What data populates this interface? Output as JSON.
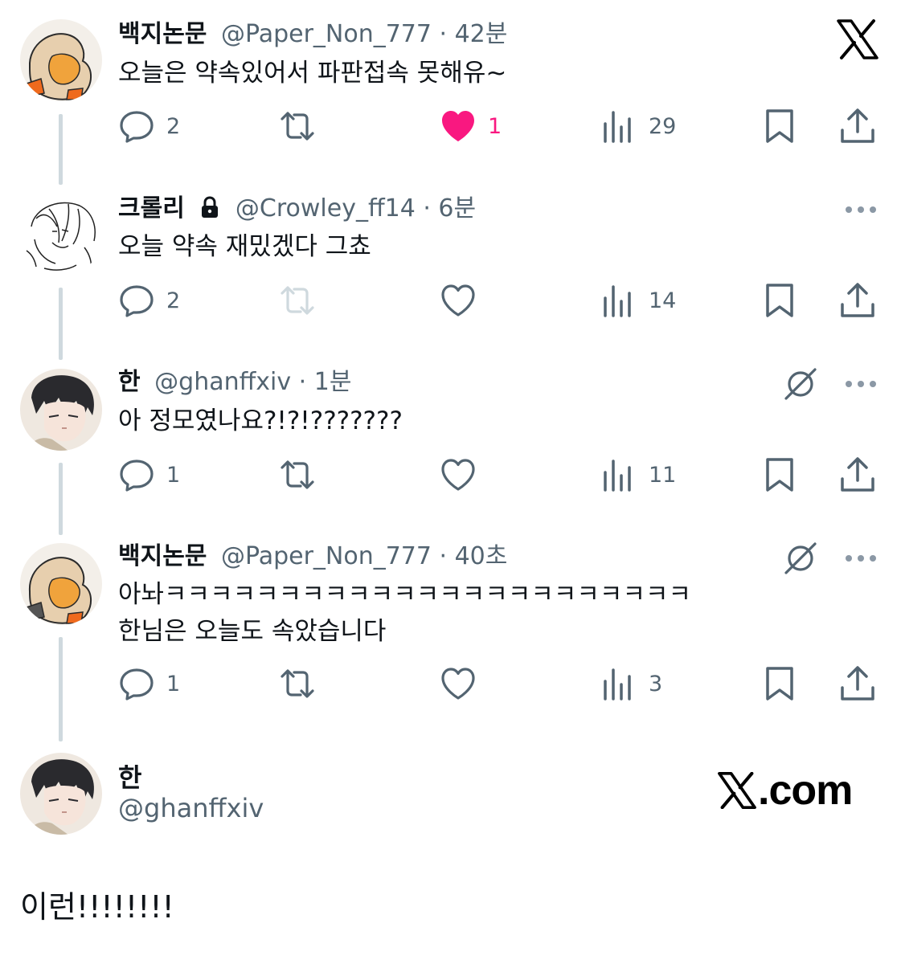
{
  "tweets": [
    {
      "name": "백지논문",
      "handle": "@Paper_Non_777",
      "sep": " · ",
      "time": "42분",
      "lines": [
        "오늘은 약속있어서 파판접속 못해유~"
      ],
      "actions": {
        "replies": "2",
        "retweets": "",
        "likes": "1",
        "views": "29",
        "liked": true,
        "retweet_disabled": false
      }
    },
    {
      "name": "크롤리",
      "handle": "@Crowley_ff14",
      "sep": " · ",
      "time": "6분",
      "locked": true,
      "lines": [
        "오늘 약속 재밌겠다 그쵸"
      ],
      "actions": {
        "replies": "2",
        "retweets": "",
        "likes": "",
        "views": "14",
        "liked": false,
        "retweet_disabled": true
      }
    },
    {
      "name": "한",
      "handle": "@ghanffxiv",
      "sep": " · ",
      "time": "1분",
      "lines": [
        "아 정모였나요?!?!???????"
      ],
      "actions": {
        "replies": "1",
        "retweets": "",
        "likes": "",
        "views": "11",
        "liked": false,
        "retweet_disabled": false
      }
    },
    {
      "name": "백지논문",
      "handle": "@Paper_Non_777",
      "sep": " · ",
      "time": "40초",
      "lines": [
        "아놔ㅋㅋㅋㅋㅋㅋㅋㅋㅋㅋㅋㅋㅋㅋㅋㅋㅋㅋㅋㅋㅋㅋㅋ",
        "한님은 오늘도 속았습니다"
      ],
      "actions": {
        "replies": "1",
        "retweets": "",
        "likes": "",
        "views": "3",
        "liked": false,
        "retweet_disabled": false
      }
    }
  ],
  "footer": {
    "name": "한",
    "handle": "@ghanffxiv",
    "site": ".com"
  },
  "final_text": "이런!!!!!!!!",
  "colors": {
    "like_active": "#f91880",
    "icon_gray": "#536471",
    "retweet_disabled": "#cfd9de",
    "thread_line": "#cfd9de"
  },
  "icons": {
    "reply": "speech-bubble-icon",
    "retweet": "retweet-icon",
    "like": "heart-icon",
    "views": "bar-chart-icon",
    "bookmark": "bookmark-icon",
    "share": "share-upload-icon",
    "more": "ellipsis-icon",
    "grok": "grok-icon",
    "lock": "lock-icon",
    "brand": "x-logo-icon"
  }
}
